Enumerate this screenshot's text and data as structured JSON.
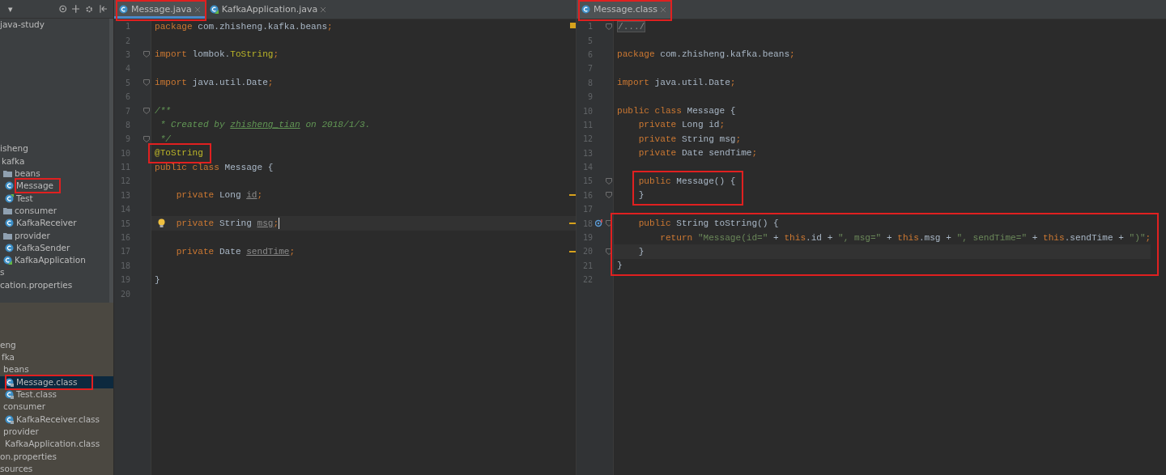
{
  "sidebar": {
    "toolbar": {
      "dropdown": "▾"
    },
    "sections": [
      {
        "kind": "project",
        "items": [
          {
            "label": "java-study",
            "selected": false,
            "boxed": false
          },
          {
            "label": "isheng",
            "selected": false,
            "boxed": false,
            "children": [
              {
                "label": "kafka",
                "selected": false,
                "boxed": false,
                "children": [
                  {
                    "label": "beans",
                    "kind": "folder",
                    "selected": false,
                    "boxed": false,
                    "children": [
                      {
                        "label": "Message",
                        "kind": "class",
                        "boxed": true,
                        "selected": false
                      },
                      {
                        "label": "Test",
                        "kind": "test",
                        "boxed": false,
                        "selected": false
                      }
                    ]
                  },
                  {
                    "label": "consumer",
                    "kind": "folder",
                    "selected": false,
                    "boxed": false,
                    "children": [
                      {
                        "label": "KafkaReceiver",
                        "kind": "class",
                        "boxed": false,
                        "selected": false
                      }
                    ]
                  },
                  {
                    "label": "provider",
                    "kind": "folder",
                    "selected": false,
                    "boxed": false,
                    "children": [
                      {
                        "label": "KafkaSender",
                        "kind": "class",
                        "boxed": false,
                        "selected": false
                      }
                    ]
                  },
                  {
                    "label": "KafkaApplication",
                    "kind": "app",
                    "boxed": false,
                    "selected": false
                  }
                ]
              }
            ]
          },
          {
            "label": "s",
            "selected": false,
            "boxed": false
          },
          {
            "label": "cation.properties",
            "selected": false,
            "boxed": false
          }
        ]
      },
      {
        "kind": "library",
        "items": [
          {
            "label": "eng",
            "selected": false,
            "boxed": false,
            "children": [
              {
                "label": "fka",
                "selected": false,
                "boxed": false,
                "children": [
                  {
                    "label": "beans",
                    "selected": false,
                    "boxed": false,
                    "children": [
                      {
                        "label": "Message.class",
                        "kind": "classfile",
                        "boxed": true,
                        "selected": true
                      },
                      {
                        "label": "Test.class",
                        "kind": "classfile",
                        "boxed": false,
                        "selected": false
                      }
                    ]
                  },
                  {
                    "label": "consumer",
                    "selected": false,
                    "boxed": false,
                    "children": [
                      {
                        "label": "KafkaReceiver.class",
                        "kind": "classfile",
                        "boxed": false,
                        "selected": false
                      }
                    ]
                  },
                  {
                    "label": "provider",
                    "selected": false,
                    "boxed": false,
                    "children": [
                      {
                        "label": "KafkaApplication.class",
                        "boxed": false,
                        "selected": false
                      }
                    ]
                  }
                ]
              }
            ]
          },
          {
            "label": "on.properties",
            "selected": false,
            "boxed": false
          },
          {
            "label": "sources",
            "selected": false,
            "boxed": false
          }
        ]
      }
    ]
  },
  "editors": [
    {
      "active": true,
      "file_warning": true,
      "tabs": [
        {
          "label": "Message.java",
          "kind": "class",
          "selected": true,
          "boxed": true
        },
        {
          "label": "KafkaApplication.java",
          "kind": "app",
          "selected": false,
          "boxed": false
        }
      ],
      "lines": [
        {
          "number": "1",
          "tokens": [
            {
              "kind": "kw",
              "text": "package"
            },
            {
              "kind": "plain",
              "text": " com.zhisheng.kafka.beans"
            },
            {
              "kind": "kw",
              "text": ";"
            }
          ],
          "fold": false,
          "warning": false,
          "bulb": false,
          "override": false,
          "current": false,
          "boxed": false
        },
        {
          "number": "2",
          "fold": false,
          "warning": false,
          "bulb": false,
          "override": false,
          "current": false,
          "boxed": false
        },
        {
          "number": "3",
          "tokens": [
            {
              "kind": "kw",
              "text": "import"
            },
            {
              "kind": "plain",
              "text": " lombok."
            },
            {
              "kind": "anno",
              "text": "ToString"
            },
            {
              "kind": "kw",
              "text": ";"
            }
          ],
          "fold": true,
          "warning": false,
          "bulb": false,
          "override": false,
          "current": false,
          "boxed": false
        },
        {
          "number": "4",
          "fold": false,
          "warning": false,
          "bulb": false,
          "override": false,
          "current": false,
          "boxed": false
        },
        {
          "number": "5",
          "tokens": [
            {
              "kind": "kw",
              "text": "import"
            },
            {
              "kind": "plain",
              "text": " java.util.Date"
            },
            {
              "kind": "kw",
              "text": ";"
            }
          ],
          "fold": true,
          "warning": false,
          "bulb": false,
          "override": false,
          "current": false,
          "boxed": false
        },
        {
          "number": "6",
          "fold": false,
          "warning": false,
          "bulb": false,
          "override": false,
          "current": false,
          "boxed": false
        },
        {
          "number": "7",
          "tokens": [
            {
              "kind": "doc",
              "text": "/**"
            }
          ],
          "fold": true,
          "warning": false,
          "bulb": false,
          "override": false,
          "current": false,
          "boxed": false
        },
        {
          "number": "8",
          "tokens": [
            {
              "kind": "doc",
              "text": " * Created by "
            },
            {
              "kind": "doclink",
              "text": "zhisheng_tian"
            },
            {
              "kind": "doc",
              "text": " on 2018/1/3."
            }
          ],
          "fold": false,
          "warning": false,
          "bulb": false,
          "override": false,
          "current": false,
          "boxed": false
        },
        {
          "number": "9",
          "tokens": [
            {
              "kind": "doc",
              "text": " */"
            }
          ],
          "fold": true,
          "warning": false,
          "bulb": false,
          "override": false,
          "current": false,
          "boxed": false
        },
        {
          "number": "10",
          "tokens": [
            {
              "kind": "anno",
              "text": "@ToString"
            }
          ],
          "fold": false,
          "warning": false,
          "bulb": false,
          "override": false,
          "current": false,
          "boxed": true
        },
        {
          "number": "11",
          "tokens": [
            {
              "kind": "kw",
              "text": "public class "
            },
            {
              "kind": "plain",
              "text": "Message {"
            }
          ],
          "fold": false,
          "warning": false,
          "bulb": false,
          "override": false,
          "current": false,
          "boxed": false
        },
        {
          "number": "12",
          "fold": false,
          "warning": false,
          "bulb": false,
          "override": false,
          "current": false,
          "boxed": false
        },
        {
          "number": "13",
          "tokens": [
            {
              "kind": "kw",
              "text": "    private "
            },
            {
              "kind": "plain",
              "text": "Long "
            },
            {
              "kind": "unused",
              "text": "id"
            },
            {
              "kind": "kw",
              "text": ";"
            }
          ],
          "fold": false,
          "warning": true,
          "bulb": false,
          "override": false,
          "current": false,
          "boxed": false
        },
        {
          "number": "14",
          "fold": false,
          "warning": false,
          "bulb": false,
          "override": false,
          "current": false,
          "boxed": false
        },
        {
          "number": "15",
          "tokens": [
            {
              "kind": "kw",
              "text": "    private "
            },
            {
              "kind": "plain",
              "text": "String "
            },
            {
              "kind": "unused",
              "text": "msg"
            },
            {
              "kind": "kw",
              "text": ";"
            }
          ],
          "fold": false,
          "warning": true,
          "bulb": true,
          "override": false,
          "current": true,
          "boxed": false
        },
        {
          "number": "16",
          "fold": false,
          "warning": false,
          "bulb": false,
          "override": false,
          "current": false,
          "boxed": false
        },
        {
          "number": "17",
          "tokens": [
            {
              "kind": "kw",
              "text": "    private "
            },
            {
              "kind": "plain",
              "text": "Date "
            },
            {
              "kind": "unused",
              "text": "sendTime"
            },
            {
              "kind": "kw",
              "text": ";"
            }
          ],
          "fold": false,
          "warning": true,
          "bulb": false,
          "override": false,
          "current": false,
          "boxed": false
        },
        {
          "number": "18",
          "fold": false,
          "warning": false,
          "bulb": false,
          "override": false,
          "current": false,
          "boxed": false
        },
        {
          "number": "19",
          "tokens": [
            {
              "kind": "plain",
              "text": "}"
            }
          ],
          "fold": false,
          "warning": false,
          "bulb": false,
          "override": false,
          "current": false,
          "boxed": false
        },
        {
          "number": "20",
          "fold": false,
          "warning": false,
          "bulb": false,
          "override": false,
          "current": false,
          "boxed": false
        }
      ]
    },
    {
      "active": false,
      "tabs": [
        {
          "label": "Message.class",
          "kind": "class",
          "selected": true,
          "boxed": true
        }
      ],
      "lines": [
        {
          "number": "1",
          "tokens": [
            {
              "kind": "folded",
              "text": "/.../"
            }
          ],
          "fold": true,
          "warning": false,
          "bulb": false,
          "override": false,
          "current": false,
          "boxed": false
        },
        {
          "number": "5",
          "fold": false,
          "warning": false,
          "bulb": false,
          "override": false,
          "current": false,
          "boxed": false
        },
        {
          "number": "6",
          "tokens": [
            {
              "kind": "kw",
              "text": "package"
            },
            {
              "kind": "plain",
              "text": " com.zhisheng.kafka.beans"
            },
            {
              "kind": "kw",
              "text": ";"
            }
          ],
          "fold": false,
          "warning": false,
          "bulb": false,
          "override": false,
          "current": false,
          "boxed": false
        },
        {
          "number": "7",
          "fold": false,
          "warning": false,
          "bulb": false,
          "override": false,
          "current": false,
          "boxed": false
        },
        {
          "number": "8",
          "tokens": [
            {
              "kind": "kw",
              "text": "import"
            },
            {
              "kind": "plain",
              "text": " java.util.Date"
            },
            {
              "kind": "kw",
              "text": ";"
            }
          ],
          "fold": false,
          "warning": false,
          "bulb": false,
          "override": false,
          "current": false,
          "boxed": false
        },
        {
          "number": "9",
          "fold": false,
          "warning": false,
          "bulb": false,
          "override": false,
          "current": false,
          "boxed": false
        },
        {
          "number": "10",
          "tokens": [
            {
              "kind": "kw",
              "text": "public class "
            },
            {
              "kind": "plain",
              "text": "Message {"
            }
          ],
          "fold": false,
          "warning": false,
          "bulb": false,
          "override": false,
          "current": false,
          "boxed": false
        },
        {
          "number": "11",
          "tokens": [
            {
              "kind": "kw",
              "text": "    private "
            },
            {
              "kind": "plain",
              "text": "Long id"
            },
            {
              "kind": "kw",
              "text": ";"
            }
          ],
          "fold": false,
          "warning": false,
          "bulb": false,
          "override": false,
          "current": false,
          "boxed": false
        },
        {
          "number": "12",
          "tokens": [
            {
              "kind": "kw",
              "text": "    private "
            },
            {
              "kind": "plain",
              "text": "String msg"
            },
            {
              "kind": "kw",
              "text": ";"
            }
          ],
          "fold": false,
          "warning": false,
          "bulb": false,
          "override": false,
          "current": false,
          "boxed": false
        },
        {
          "number": "13",
          "tokens": [
            {
              "kind": "kw",
              "text": "    private "
            },
            {
              "kind": "plain",
              "text": "Date sendTime"
            },
            {
              "kind": "kw",
              "text": ";"
            }
          ],
          "fold": false,
          "warning": false,
          "bulb": false,
          "override": false,
          "current": false,
          "boxed": false
        },
        {
          "number": "14",
          "fold": false,
          "warning": false,
          "bulb": false,
          "override": false,
          "current": false,
          "boxed": false
        },
        {
          "number": "15",
          "tokens": [
            {
              "kind": "kw",
              "text": "    public "
            },
            {
              "kind": "plain",
              "text": "Message() {"
            }
          ],
          "fold": true,
          "warning": false,
          "bulb": false,
          "override": false,
          "current": false,
          "boxed": true
        },
        {
          "number": "16",
          "tokens": [
            {
              "kind": "plain",
              "text": "    }"
            }
          ],
          "fold": true,
          "warning": false,
          "bulb": false,
          "override": false,
          "current": false,
          "boxed": true
        },
        {
          "number": "17",
          "fold": false,
          "warning": false,
          "bulb": false,
          "override": false,
          "current": false,
          "boxed": false
        },
        {
          "number": "18",
          "tokens": [
            {
              "kind": "kw",
              "text": "    public "
            },
            {
              "kind": "plain",
              "text": "String toString() {"
            }
          ],
          "fold": true,
          "warning": false,
          "bulb": false,
          "override": true,
          "current": false,
          "boxed": true
        },
        {
          "number": "19",
          "tokens": [
            {
              "kind": "kw",
              "text": "        return "
            },
            {
              "kind": "str",
              "text": "\"Message(id=\""
            },
            {
              "kind": "plain",
              "text": " + "
            },
            {
              "kind": "kw",
              "text": "this"
            },
            {
              "kind": "plain",
              "text": ".id + "
            },
            {
              "kind": "str",
              "text": "\", msg=\""
            },
            {
              "kind": "plain",
              "text": " + "
            },
            {
              "kind": "kw",
              "text": "this"
            },
            {
              "kind": "plain",
              "text": ".msg + "
            },
            {
              "kind": "str",
              "text": "\", sendTime=\""
            },
            {
              "kind": "plain",
              "text": " + "
            },
            {
              "kind": "kw",
              "text": "this"
            },
            {
              "kind": "plain",
              "text": ".sendTime + "
            },
            {
              "kind": "str",
              "text": "\")\""
            },
            {
              "kind": "kw",
              "text": ";"
            }
          ],
          "fold": false,
          "warning": false,
          "bulb": false,
          "override": false,
          "current": false,
          "boxed": true
        },
        {
          "number": "20",
          "tokens": [
            {
              "kind": "plain",
              "text": "    }"
            }
          ],
          "fold": true,
          "warning": false,
          "bulb": false,
          "override": false,
          "current": true,
          "boxed": true
        },
        {
          "number": "21",
          "tokens": [
            {
              "kind": "plain",
              "text": "}"
            }
          ],
          "fold": false,
          "warning": false,
          "bulb": false,
          "override": false,
          "current": false,
          "boxed": true
        },
        {
          "number": "22",
          "fold": false,
          "warning": false,
          "bulb": false,
          "override": false,
          "current": false,
          "boxed": false
        }
      ]
    }
  ]
}
